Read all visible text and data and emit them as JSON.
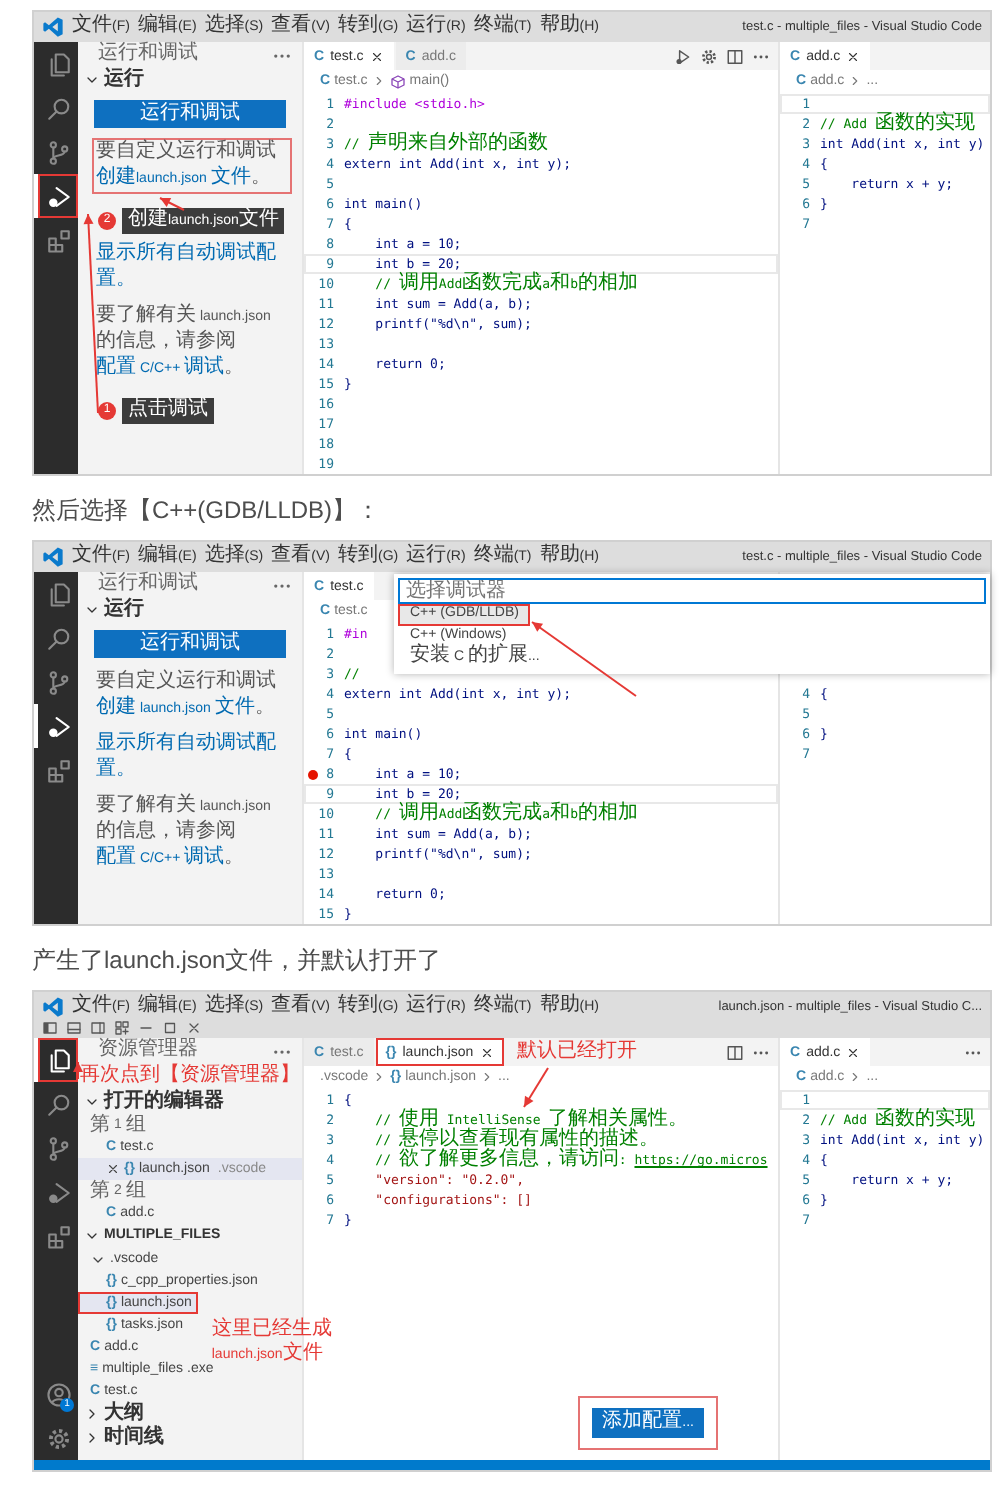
{
  "content": [
    {
      "kind": "screenshot",
      "titlebar": {
        "menu": [
          "文件(F)",
          "编辑(E)",
          "选择(S)",
          "查看(V)",
          "转到(G)",
          "运行(R)",
          "终端(T)",
          "帮助(H)"
        ],
        "title": "test.c - multiple_files - Visual Studio Code"
      },
      "activity_bar": {
        "items": [
          {
            "kind": "files",
            "selected": false
          },
          {
            "kind": "search",
            "selected": false
          },
          {
            "kind": "source-control",
            "selected": false
          },
          {
            "kind": "run",
            "selected": true,
            "annotated": true
          },
          {
            "kind": "extensions",
            "selected": false
          }
        ]
      },
      "sidebar": {
        "kind": "run",
        "title": "运行和调试",
        "section": {
          "label": "运行",
          "expanded": true
        },
        "button": "运行和调试",
        "paragraphs": [
          {
            "annotated": true,
            "parts": [
              {
                "text": "要自定义运行和调试"
              },
              {
                "text": "创建launch.json 文件",
                "link": true
              },
              {
                "text": "。"
              }
            ]
          },
          {
            "annotated": false,
            "parts": [
              {
                "text": "显示所有自动调试配置。",
                "link": true
              }
            ]
          },
          {
            "annotated": false,
            "parts": [
              {
                "text": "要了解有关 launch.json 的信息，请参阅 "
              },
              {
                "text": "配置 C/C++ 调试",
                "link": true
              },
              {
                "text": "。"
              }
            ]
          }
        ],
        "callouts": [
          {
            "number": "2",
            "label": "创建launch.json文件"
          },
          {
            "number": "1",
            "label": "点击调试"
          }
        ]
      },
      "editor_groups": [
        {
          "tabs": [
            {
              "icon": "C",
              "label": "test.c",
              "selected": true,
              "closable": true
            },
            {
              "icon": "C",
              "label": "add.c",
              "selected": false
            }
          ],
          "breadcrumb": [
            {
              "icon": "C",
              "label": "test.c"
            },
            {
              "kind": "function",
              "label": "main()"
            }
          ],
          "lines": [
            {
              "n": "1",
              "kind": "directive",
              "code": "#include <stdio.h>"
            },
            {
              "n": "2"
            },
            {
              "n": "3",
              "kind": "comment",
              "code": "// 声明来自外部的函数"
            },
            {
              "n": "4",
              "kind": "code",
              "code": "extern int Add(int x, int y);"
            },
            {
              "n": "5"
            },
            {
              "n": "6",
              "kind": "code",
              "code": "int main()"
            },
            {
              "n": "7",
              "kind": "code",
              "code": "{"
            },
            {
              "n": "8",
              "kind": "code",
              "code": "    int a = 10;"
            },
            {
              "n": "9",
              "kind": "code",
              "code": "    int b = 20;",
              "current": true
            },
            {
              "n": "10",
              "kind": "comment",
              "code": "    // 调用Add函数完成a和b的相加"
            },
            {
              "n": "11",
              "kind": "code",
              "code": "    int sum = Add(a, b);"
            },
            {
              "n": "12",
              "kind": "code",
              "code": "    printf(\"%d\\n\", sum);"
            },
            {
              "n": "13"
            },
            {
              "n": "14",
              "kind": "code",
              "code": "    return 0;"
            },
            {
              "n": "15",
              "kind": "code",
              "code": "}"
            },
            {
              "n": "16"
            },
            {
              "n": "17"
            },
            {
              "n": "18"
            },
            {
              "n": "19"
            }
          ]
        },
        {
          "tabs": [
            {
              "icon": "C",
              "label": "add.c",
              "selected": true,
              "closable": true
            }
          ],
          "breadcrumb": [
            {
              "icon": "C",
              "label": "add.c"
            },
            {
              "label": "..."
            }
          ],
          "lines": [
            {
              "n": "1",
              "current": true
            },
            {
              "n": "2",
              "kind": "comment",
              "code": "// Add 函数的实现"
            },
            {
              "n": "3",
              "kind": "code",
              "code": "int Add(int x, int y)"
            },
            {
              "n": "4",
              "kind": "code",
              "code": "{"
            },
            {
              "n": "5",
              "kind": "code",
              "code": "    return x + y;"
            },
            {
              "n": "6",
              "kind": "code",
              "code": "}"
            },
            {
              "n": "7"
            }
          ]
        }
      ]
    },
    {
      "kind": "caption",
      "text": "然后选择【C++(GDB/LLDB)】："
    },
    {
      "kind": "screenshot",
      "titlebar": {
        "menu": [
          "文件(F)",
          "编辑(E)",
          "选择(S)",
          "查看(V)",
          "转到(G)",
          "运行(R)",
          "终端(T)",
          "帮助(H)"
        ],
        "title": "test.c - multiple_files - Visual Studio Code"
      },
      "activity_bar": {
        "items": [
          {
            "kind": "files",
            "selected": false
          },
          {
            "kind": "search",
            "selected": false
          },
          {
            "kind": "source-control",
            "selected": false
          },
          {
            "kind": "run",
            "selected": true
          },
          {
            "kind": "extensions",
            "selected": false
          }
        ]
      },
      "sidebar": {
        "kind": "run",
        "title": "运行和调试",
        "section": {
          "label": "运行",
          "expanded": true
        },
        "button": "运行和调试",
        "paragraphs": [
          {
            "annotated": false,
            "parts": [
              {
                "text": "要自定义运行和调试"
              },
              {
                "text": "创建 launch.json 文件",
                "link": true
              },
              {
                "text": "。"
              }
            ]
          },
          {
            "annotated": false,
            "parts": [
              {
                "text": "显示所有自动调试配置。",
                "link": true
              }
            ]
          },
          {
            "annotated": false,
            "parts": [
              {
                "text": "要了解有关 launch.json 的信息，请参阅 "
              },
              {
                "text": "配置 C/C++ 调试",
                "link": true
              },
              {
                "text": "。"
              }
            ]
          }
        ]
      },
      "editor_groups": [
        {
          "tabs": [
            {
              "icon": "C",
              "label": "test.c",
              "selected": true
            }
          ],
          "breadcrumb": [
            {
              "icon": "C",
              "label": "test.c"
            }
          ],
          "lines": [
            {
              "n": "1",
              "kind": "directive",
              "code": "#in"
            },
            {
              "n": "2"
            },
            {
              "n": "3",
              "kind": "comment",
              "code": "//"
            },
            {
              "n": "4",
              "kind": "code",
              "code": "extern int Add(int x, int y);"
            },
            {
              "n": "5"
            },
            {
              "n": "6",
              "kind": "code",
              "code": "int main()"
            },
            {
              "n": "7",
              "kind": "code",
              "code": "{"
            },
            {
              "n": "8",
              "kind": "code",
              "code": "    int a = 10;",
              "breakpoint": true
            },
            {
              "n": "9",
              "kind": "code",
              "code": "    int b = 20;",
              "current": true
            },
            {
              "n": "10",
              "kind": "comment",
              "code": "    // 调用Add函数完成a和b的相加"
            },
            {
              "n": "11",
              "kind": "code",
              "code": "    int sum = Add(a, b);"
            },
            {
              "n": "12",
              "kind": "code",
              "code": "    printf(\"%d\\n\", sum);"
            },
            {
              "n": "13"
            },
            {
              "n": "14",
              "kind": "code",
              "code": "    return 0;"
            },
            {
              "n": "15",
              "kind": "code",
              "code": "}"
            }
          ]
        },
        {
          "lines": [
            {
              "n": "4",
              "kind": "code",
              "code": "{"
            },
            {
              "n": "5"
            },
            {
              "n": "6",
              "kind": "code",
              "code": "}"
            },
            {
              "n": "7"
            }
          ]
        }
      ],
      "quick_pick": {
        "placeholder": "选择调试器",
        "items": [
          {
            "label": "C++ (GDB/LLDB)",
            "selected": true,
            "annotated": true
          },
          {
            "label": "C++ (Windows)",
            "selected": false
          },
          {
            "label": "安装 C 的扩展...",
            "selected": false
          }
        ]
      }
    },
    {
      "kind": "caption",
      "text": "产生了launch.json文件，并默认打开了"
    },
    {
      "kind": "screenshot",
      "titlebar": {
        "menu": [
          "文件(F)",
          "编辑(E)",
          "选择(S)",
          "查看(V)",
          "转到(G)",
          "运行(R)",
          "终端(T)",
          "帮助(H)"
        ],
        "title": "launch.json - multiple_files - Visual Studio C...",
        "window_controls": true
      },
      "activity_bar": {
        "items": [
          {
            "kind": "files",
            "selected": true,
            "annotated": true
          },
          {
            "kind": "search",
            "selected": false
          },
          {
            "kind": "source-control",
            "selected": false
          },
          {
            "kind": "run",
            "selected": false
          },
          {
            "kind": "extensions",
            "selected": false
          }
        ],
        "bottom_icons": true,
        "account_badge": "1"
      },
      "sidebar": {
        "kind": "explorer",
        "title": "资源管理器",
        "annotation": "再次点到【资源管理器】",
        "sections": [
          {
            "label": "打开的编辑器",
            "expanded": true,
            "items": [
              {
                "kind": "group",
                "label": "第 1 组",
                "selected": false,
                "children": [
                  {
                    "kind": "file",
                    "icon": "C",
                    "label": "test.c",
                    "selected": false
                  },
                  {
                    "kind": "file",
                    "icon": "{}",
                    "label": "launch.json",
                    "description": ".vscode",
                    "closable": true,
                    "selected": true
                  }
                ]
              },
              {
                "kind": "group",
                "label": "第 2 组",
                "selected": false,
                "children": [
                  {
                    "kind": "file",
                    "icon": "C",
                    "label": "add.c",
                    "selected": false
                  }
                ]
              }
            ]
          },
          {
            "label": "MULTIPLE_FILES",
            "expanded": true,
            "items": [
              {
                "kind": "folder",
                "label": ".vscode",
                "expanded": true,
                "selected": false,
                "children": [
                  {
                    "kind": "file",
                    "icon": "{}",
                    "label": "c_cpp_properties.json",
                    "selected": false
                  },
                  {
                    "kind": "file",
                    "icon": "{}",
                    "label": "launch.json",
                    "selected": true,
                    "annotated": true,
                    "note": "这里已经生成launch.json文件"
                  },
                  {
                    "kind": "file",
                    "icon": "{}",
                    "label": "tasks.json",
                    "selected": false
                  }
                ]
              },
              {
                "kind": "file",
                "icon": "C",
                "label": "add.c",
                "selected": false
              },
              {
                "kind": "file",
                "icon": "≡",
                "label": "multiple_files .exe",
                "selected": false
              },
              {
                "kind": "file",
                "icon": "C",
                "label": "test.c",
                "selected": false
              }
            ]
          },
          {
            "label": "大纲",
            "expanded": false
          },
          {
            "label": "时间线",
            "expanded": false
          }
        ]
      },
      "editor_groups": [
        {
          "tabs": [
            {
              "icon": "C",
              "label": "test.c",
              "selected": false
            },
            {
              "icon": "{}",
              "label": "launch.json",
              "selected": true,
              "closable": true,
              "annotated": true
            }
          ],
          "tab_note": "默认已经打开",
          "breadcrumb": [
            {
              "label": ".vscode"
            },
            {
              "icon": "{}",
              "label": "launch.json"
            },
            {
              "label": "..."
            }
          ],
          "lines": [
            {
              "n": "1",
              "kind": "code",
              "code": "{"
            },
            {
              "n": "2",
              "kind": "comment",
              "code": "    // 使用 IntelliSense 了解相关属性。"
            },
            {
              "n": "3",
              "kind": "comment",
              "code": "    // 悬停以查看现有属性的描述。"
            },
            {
              "n": "4",
              "kind": "comment",
              "code": "    // 欲了解更多信息，请访问: ",
              "link": "https://go.micros"
            },
            {
              "n": "5",
              "kind": "property",
              "code": "    \"version\": \"0.2.0\","
            },
            {
              "n": "6",
              "kind": "property",
              "code": "    \"configurations\": []"
            },
            {
              "n": "7",
              "kind": "code",
              "code": "}"
            }
          ],
          "button": {
            "label": "添加配置...",
            "annotated": true
          }
        },
        {
          "tabs": [
            {
              "icon": "C",
              "label": "add.c",
              "selected": true,
              "closable": true
            }
          ],
          "breadcrumb": [
            {
              "icon": "C",
              "label": "add.c"
            },
            {
              "label": "..."
            }
          ],
          "lines": [
            {
              "n": "1",
              "current": true
            },
            {
              "n": "2",
              "kind": "comment",
              "code": "// Add 函数的实现"
            },
            {
              "n": "3",
              "kind": "code",
              "code": "int Add(int x, int y)"
            },
            {
              "n": "4",
              "kind": "code",
              "code": "{"
            },
            {
              "n": "5",
              "kind": "code",
              "code": "    return x + y;"
            },
            {
              "n": "6",
              "kind": "code",
              "code": "}"
            },
            {
              "n": "7"
            }
          ]
        }
      ],
      "status_bar": true
    }
  ]
}
